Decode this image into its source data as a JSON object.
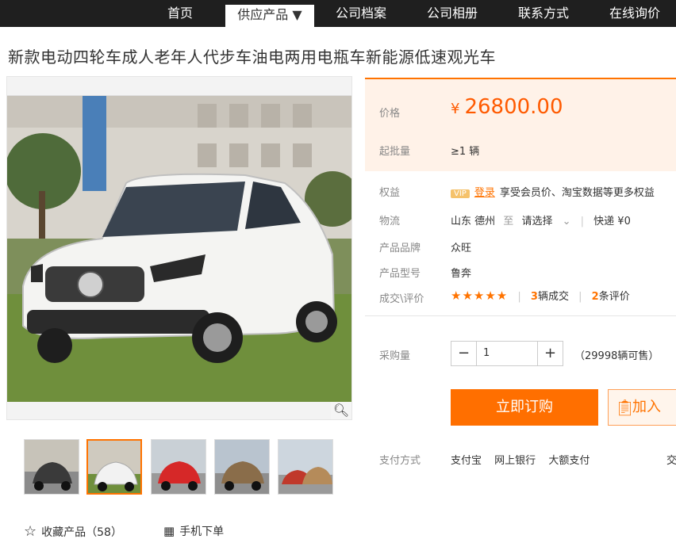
{
  "nav": {
    "items": [
      {
        "label": "首页"
      },
      {
        "label": "供应产品 ▼"
      },
      {
        "label": "公司档案"
      },
      {
        "label": "公司相册"
      },
      {
        "label": "联系方式"
      },
      {
        "label": "在线询价"
      }
    ]
  },
  "product": {
    "title": "新款电动四轮车成人老年人代步车油电两用电瓶车新能源低速观光车"
  },
  "price": {
    "label": "价格",
    "currency": "¥",
    "value": "26800.00",
    "min_label": "起批量",
    "min_value": "≥1 辆"
  },
  "benefits": {
    "label": "权益",
    "vip": "VIP",
    "login": "登录",
    "text": "享受会员价、淘宝数据等更多权益"
  },
  "logistics": {
    "label": "物流",
    "from": "山东 德州",
    "to_label": "至",
    "select": "请选择",
    "express": "快递 ¥0"
  },
  "brand": {
    "label": "产品品牌",
    "value": "众旺"
  },
  "model": {
    "label": "产品型号",
    "value": "鲁奔"
  },
  "deals": {
    "label": "成交\\评价",
    "stars": "★★★★★",
    "sold_count": "3",
    "sold_text": "辆成交",
    "review_count": "2",
    "review_text": "条评价"
  },
  "purchase": {
    "label": "采购量",
    "qty": "1",
    "stock": "（29998辆可售）"
  },
  "actions": {
    "buy": "立即订购",
    "cart": "加入"
  },
  "payment": {
    "label": "支付方式",
    "options": [
      "支付宝",
      "网上银行",
      "大额支付"
    ],
    "extra": "交"
  },
  "bottom": {
    "fav": "收藏产品（58）",
    "mobile": "手机下单"
  },
  "colors": {
    "accent": "#ff7300",
    "nav_bg": "#1f1f1f"
  }
}
